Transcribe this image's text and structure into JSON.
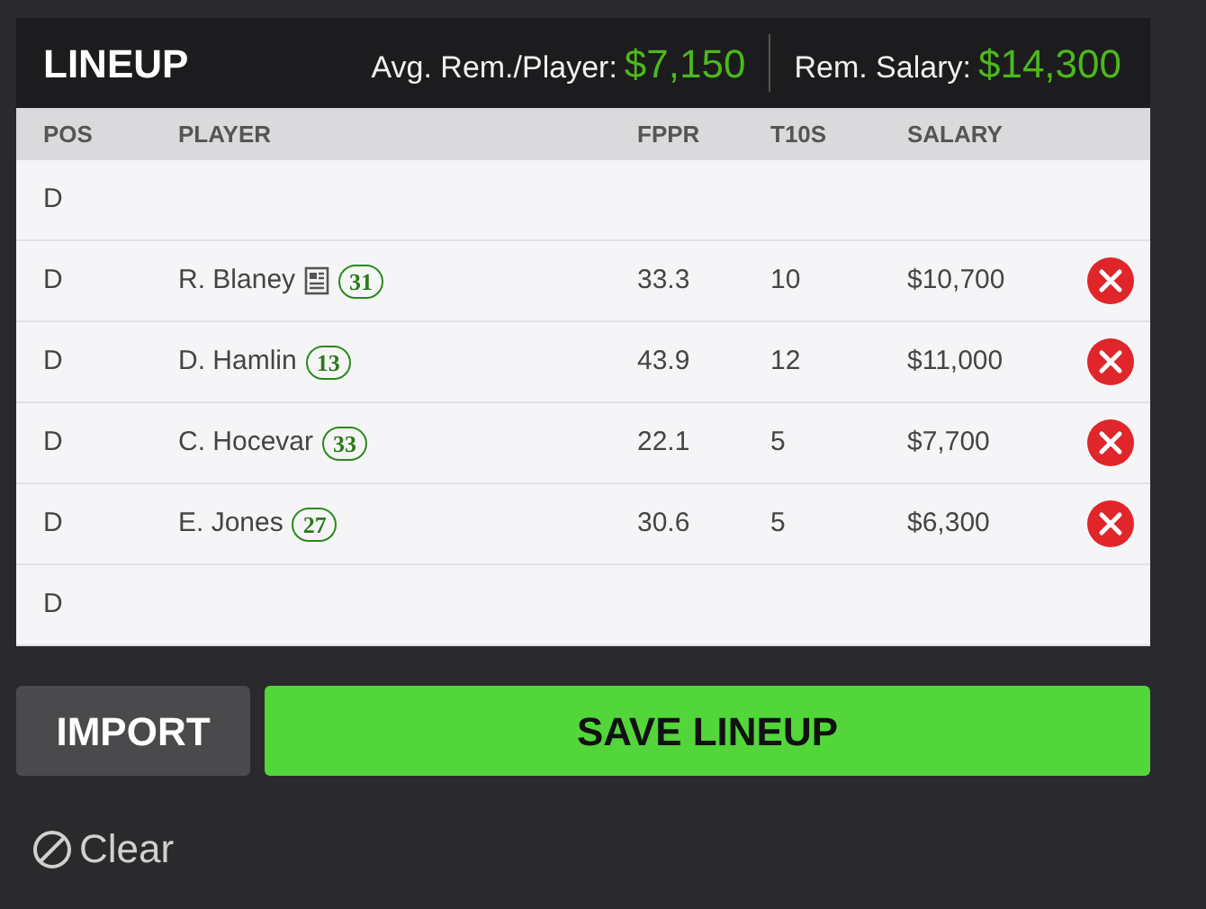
{
  "header": {
    "title": "LINEUP",
    "stats": [
      {
        "label": "Avg. Rem./Player:",
        "value": "$7,150"
      },
      {
        "label": "Rem. Salary:",
        "value": "$14,300"
      }
    ]
  },
  "table": {
    "columns": [
      "POS",
      "PLAYER",
      "FPPR",
      "T10S",
      "SALARY"
    ],
    "rows": [
      {
        "pos": "D"
      },
      {
        "pos": "D",
        "player": "R. Blaney",
        "has_note": true,
        "number": "31",
        "fppr": "33.3",
        "t10s": "10",
        "salary": "$10,700"
      },
      {
        "pos": "D",
        "player": "D. Hamlin",
        "has_note": false,
        "number": "13",
        "fppr": "43.9",
        "t10s": "12",
        "salary": "$11,000"
      },
      {
        "pos": "D",
        "player": "C. Hocevar",
        "has_note": false,
        "number": "33",
        "fppr": "22.1",
        "t10s": "5",
        "salary": "$7,700"
      },
      {
        "pos": "D",
        "player": "E. Jones",
        "has_note": false,
        "number": "27",
        "fppr": "30.6",
        "t10s": "5",
        "salary": "$6,300"
      },
      {
        "pos": "D"
      }
    ]
  },
  "buttons": {
    "import": "IMPORT",
    "save": "SAVE LINEUP"
  },
  "clear": "Clear"
}
